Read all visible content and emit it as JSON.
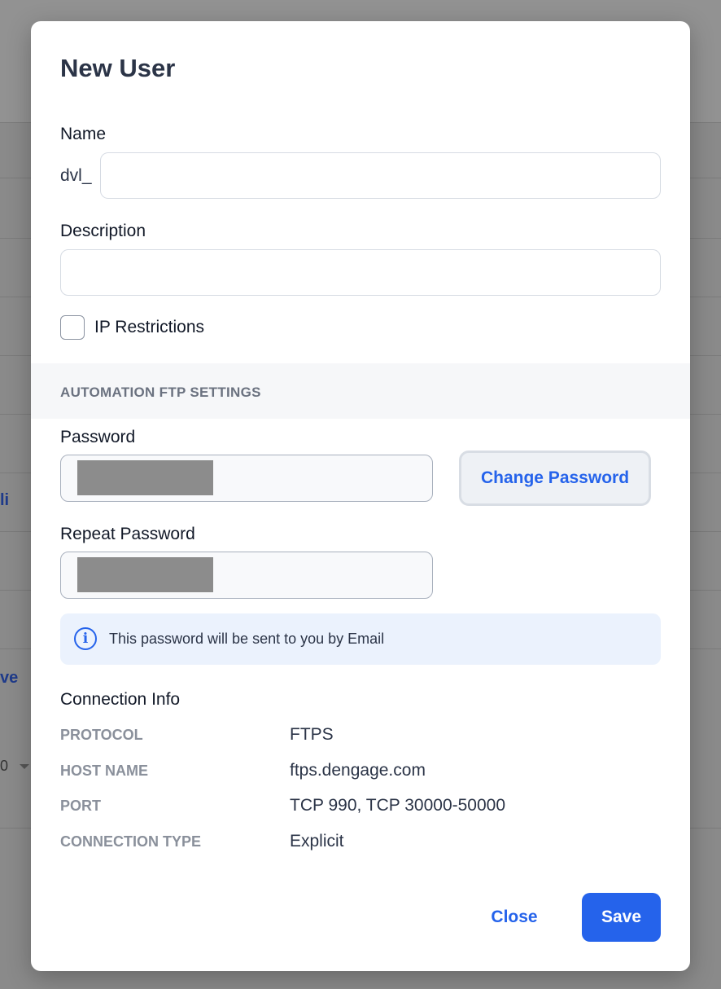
{
  "background": {
    "partial_texts": [
      "li",
      "ve",
      "0"
    ]
  },
  "modal": {
    "title": "New User",
    "name": {
      "label": "Name",
      "prefix": "dvl_",
      "value": ""
    },
    "description": {
      "label": "Description",
      "value": ""
    },
    "ip_restrictions": {
      "label": "IP Restrictions",
      "checked": false
    },
    "ftp_section": {
      "title": "AUTOMATION FTP SETTINGS",
      "password_label": "Password",
      "change_password_label": "Change Password",
      "repeat_password_label": "Repeat Password",
      "info_text": "This password will be sent to you by Email"
    },
    "connection_info": {
      "title": "Connection Info",
      "rows": [
        {
          "key": "PROTOCOL",
          "value": "FTPS"
        },
        {
          "key": "HOST NAME",
          "value": "ftps.dengage.com"
        },
        {
          "key": "PORT",
          "value": "TCP 990, TCP 30000-50000"
        },
        {
          "key": "CONNECTION TYPE",
          "value": "Explicit"
        }
      ]
    },
    "footer": {
      "close_label": "Close",
      "save_label": "Save"
    }
  },
  "colors": {
    "accent": "#2563eb",
    "overlay": "#8a8a8a",
    "info_bg": "#ebf2fd"
  },
  "icons": {
    "info": "info-circle-icon"
  }
}
